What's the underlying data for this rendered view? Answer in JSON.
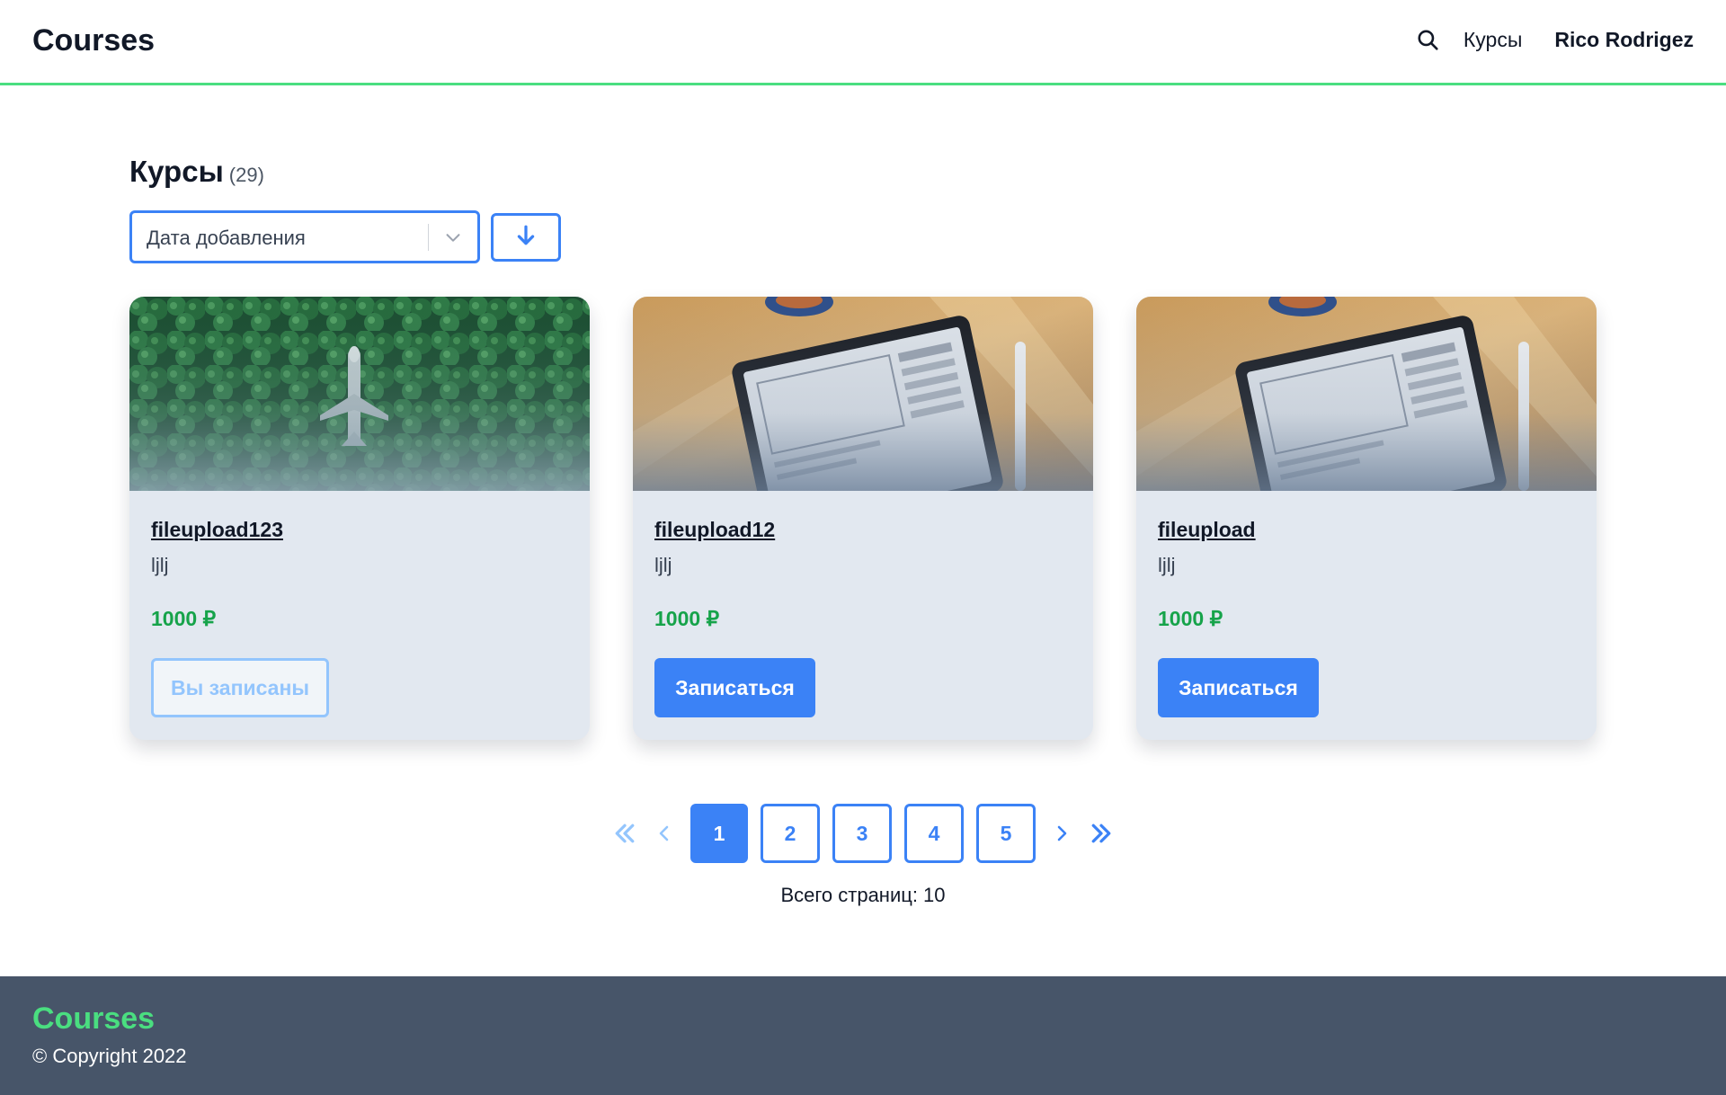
{
  "header": {
    "brand": "Courses",
    "search_icon": "search-icon",
    "nav_link": "Курсы",
    "user_name": "Rico Rodrigez"
  },
  "page": {
    "title": "Курсы",
    "count": "(29)"
  },
  "sort": {
    "selected": "Дата добавления",
    "direction_icon": "arrow-down-icon"
  },
  "courses": [
    {
      "image": "forest-airplane-image",
      "title": "fileupload123",
      "description": "ljlj",
      "price": "1000 ₽",
      "button": "Вы записаны",
      "enrolled": true
    },
    {
      "image": "tablet-desk-image",
      "title": "fileupload12",
      "description": "ljlj",
      "price": "1000 ₽",
      "button": "Записаться",
      "enrolled": false
    },
    {
      "image": "tablet-desk-image",
      "title": "fileupload",
      "description": "ljlj",
      "price": "1000 ₽",
      "button": "Записаться",
      "enrolled": false
    }
  ],
  "pagination": {
    "pages": [
      "1",
      "2",
      "3",
      "4",
      "5"
    ],
    "current": "1",
    "total_label": "Всего страниц: 10"
  },
  "footer": {
    "brand": "Courses",
    "copyright": "© Copyright 2022"
  },
  "colors": {
    "accent": "#3b82f6",
    "brand_green": "#4ade80",
    "price_green": "#16a34a",
    "footer_bg": "#475569",
    "card_bg": "#e2e8f0"
  }
}
